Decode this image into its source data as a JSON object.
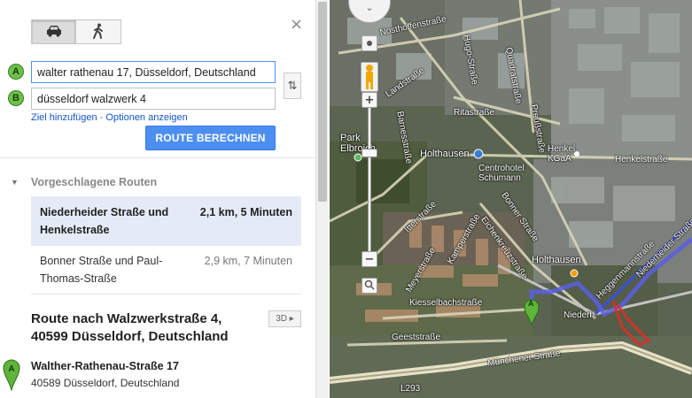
{
  "travel_modes": [
    {
      "name": "car",
      "icon": "car-icon",
      "active": true
    },
    {
      "name": "walk",
      "icon": "walk-icon",
      "active": false
    }
  ],
  "close_label": "×",
  "waypoints": {
    "a": {
      "marker": "A",
      "value": "walter rathenau 17, Düsseldorf, Deutschland"
    },
    "b": {
      "marker": "B",
      "value": "düsseldorf walzwerk 4"
    }
  },
  "swap_label": "⇅",
  "links": {
    "add_destination": "Ziel hinzufügen",
    "separator": "-",
    "show_options": "Optionen anzeigen"
  },
  "route_button": "ROUTE BERECHNEN",
  "suggested": {
    "heading": "Vorgeschlagene Routen",
    "routes": [
      {
        "name": "Niederheider Straße und Henkelstraße",
        "info": "2,1 km, 5 Minuten",
        "selected": true
      },
      {
        "name": "Bonner Straße und Paul-Thomas-Straße",
        "info": "2,9 km, 7 Minuten",
        "selected": false
      }
    ]
  },
  "directions": {
    "title": "Route nach Walzwerkstraße 4, 40599 Düsseldorf, Deutschland",
    "btn_3d": "3D ▸",
    "start_marker": "A",
    "start_name": "Walther-Rathenau-Straße 17",
    "start_addr": "40589 Düsseldorf, Deutschland"
  },
  "map": {
    "labels": {
      "nosthoffen": "Nosthoffenstraße",
      "lands": "Landstraße",
      "hugo": "Hugo-Straße",
      "ritastrasse": "Ritastraße",
      "quadrat": "Quadratstraße",
      "preuss": "Preußstraße",
      "park": "Park Elbroich",
      "barnes": "Barnesstraße",
      "holthausen": "Holthausen",
      "centrohotel": "Centrohotel Schumann",
      "henkel": "Henkel KGaA",
      "henkelstr": "Henkelstraße",
      "itter": "Itterstraße",
      "bonner": "Bonner Straße",
      "kamper": "Kamperstraße",
      "meyer": "Meyerstraße",
      "eichenkreuz": "Eichenkreuzstraße",
      "holthausen2": "Holthausen",
      "heiggen": "Heggenmannstraße",
      "niederheider": "Niederheider Straße",
      "niederh": "Niederh",
      "kiesselbach": "Kiesselbachstraße",
      "geeste": "Geeststraße",
      "muenchener": "Münchener Straße",
      "l293": "L293"
    },
    "zoom_in": "+",
    "zoom_out": "−",
    "pan_label": "⌄",
    "end_marker": "A"
  }
}
